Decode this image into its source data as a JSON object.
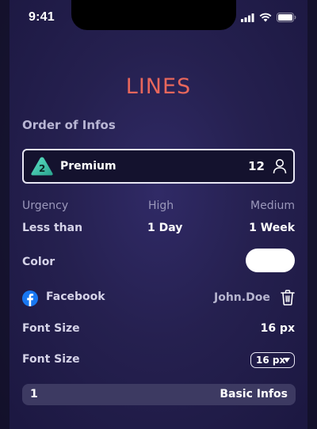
{
  "status": {
    "time": "9:41"
  },
  "header": {
    "title": "LINES",
    "title_color": "#e8675c"
  },
  "order": {
    "label": "Order of Infos",
    "premium": {
      "badge_number": "2",
      "label": "Premium",
      "count": "12",
      "icon": "user-icon"
    }
  },
  "urgency": {
    "label": "Urgency",
    "high_label": "High",
    "medium_label": "Medium",
    "threshold_label": "Less than",
    "high_value": "1 Day",
    "medium_value": "1 Week"
  },
  "color": {
    "label": "Color",
    "value": "#ffffff"
  },
  "social": {
    "platform": "Facebook",
    "icon": "facebook-icon",
    "username": "John.Doe",
    "delete_icon": "trash-icon"
  },
  "font_size_display": {
    "label": "Font Size",
    "value": "16 px"
  },
  "font_size_select": {
    "label": "Font Size",
    "selected": "16 px"
  },
  "basic_infos": {
    "number": "1",
    "label": "Basic Infos"
  }
}
